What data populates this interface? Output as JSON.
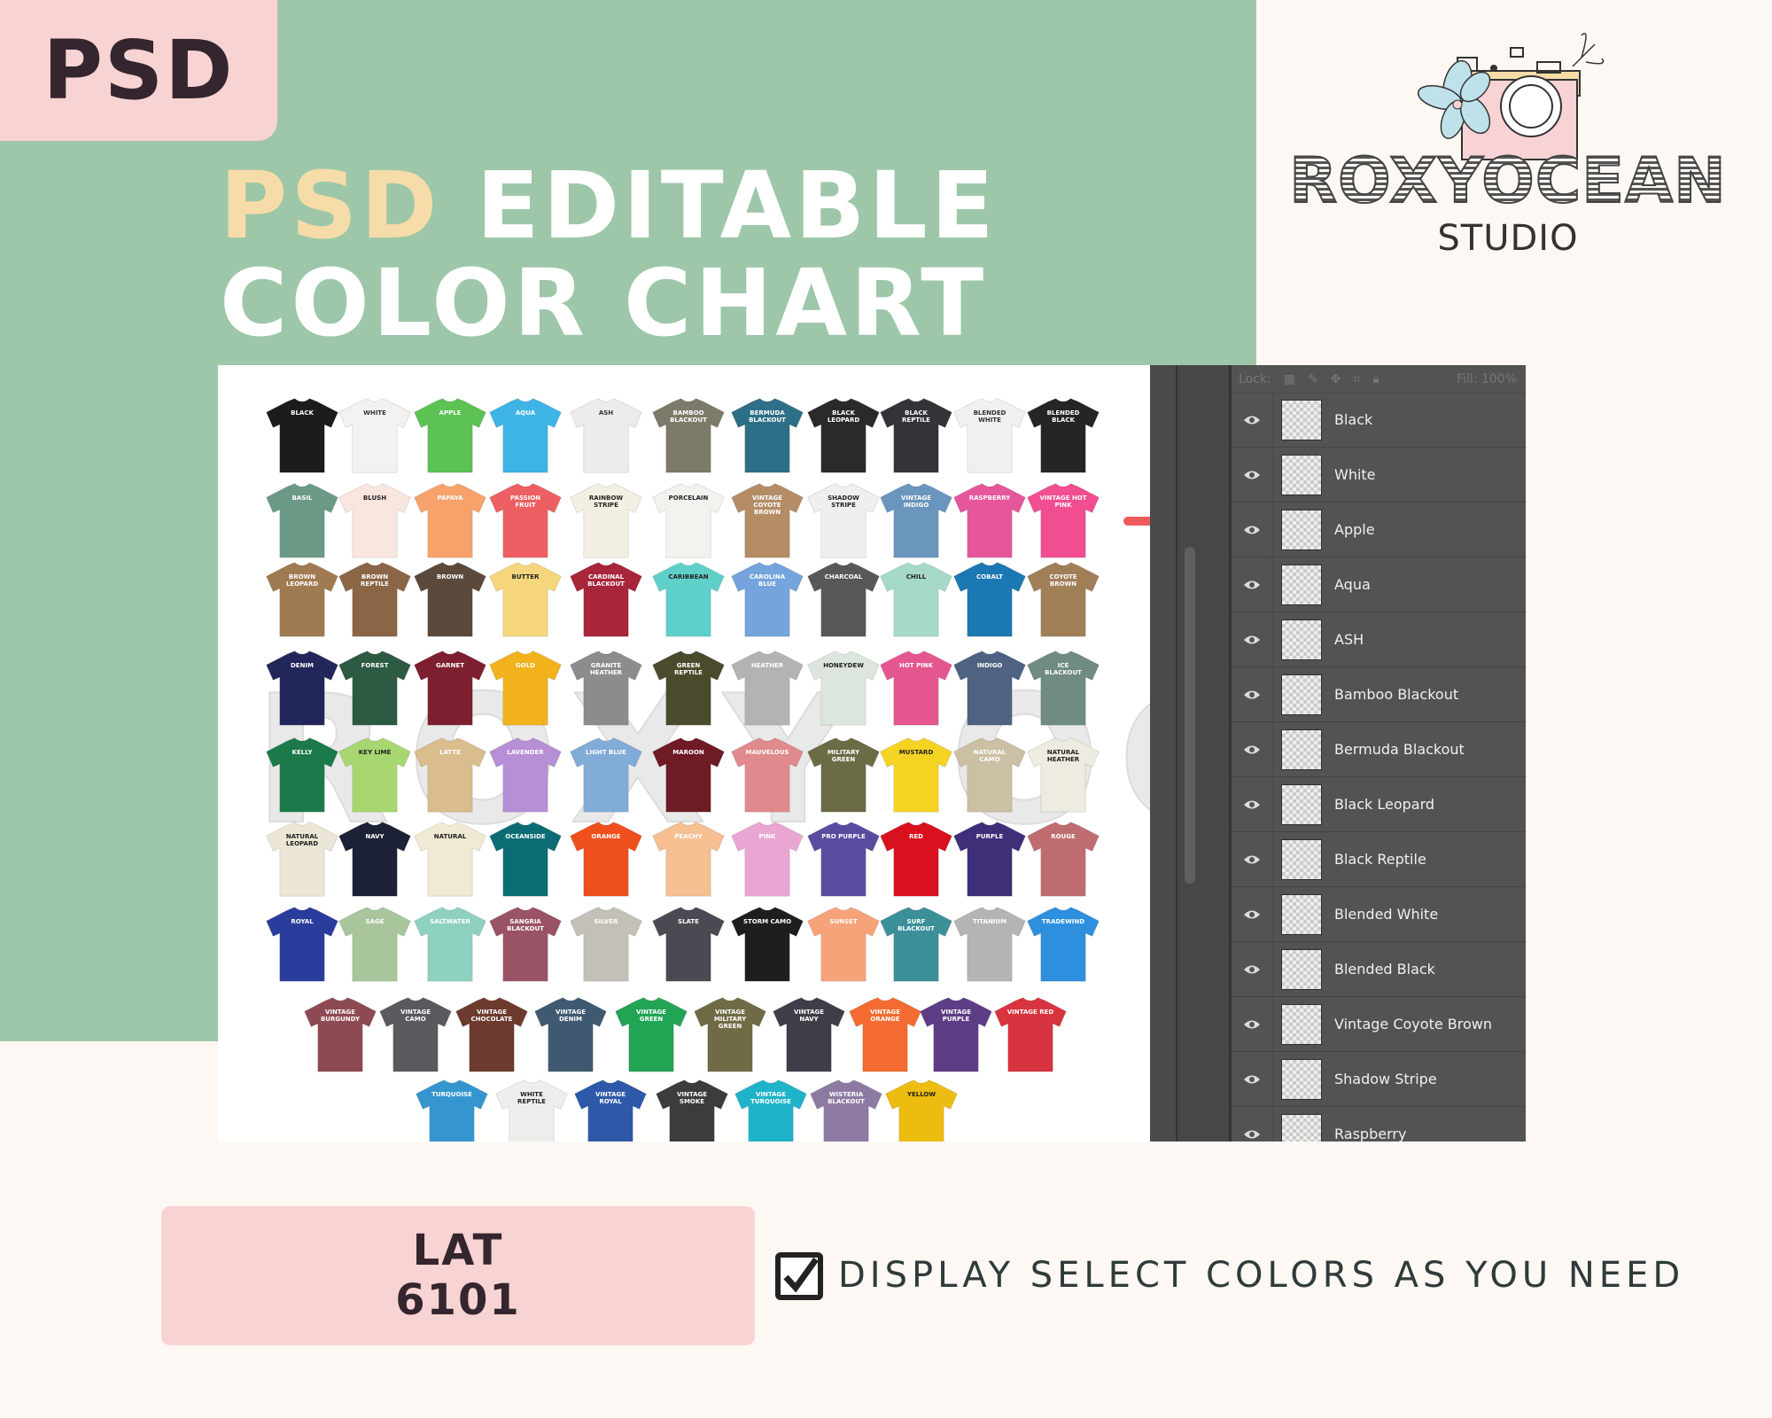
{
  "badge": {
    "text": "PSD"
  },
  "title": {
    "accent": "PSD",
    "line1_rest": "EDITABLE",
    "line2": "COLOR CHART"
  },
  "logo": {
    "name": "ROXYOCEAN",
    "sub": "STUDIO"
  },
  "colors": {
    "green": "#9dc7a8",
    "cream": "#fdf8f3",
    "pink": "#f8d3d3",
    "accent_title": "#f6dca8",
    "arrow": "#ef5b5b",
    "ps_panel": "#535353"
  },
  "chart": {
    "watermark": "ROXY OCEAN",
    "rows": [
      [
        [
          "Black",
          "#1c1c1e",
          "#fff"
        ],
        [
          "White",
          "#f3f2f0",
          "#333"
        ],
        [
          "Apple",
          "#5cc254",
          "#fff"
        ],
        [
          "Aqua",
          "#3eb3e6",
          "#fff"
        ],
        [
          "Ash",
          "#ececec",
          "#333"
        ],
        [
          "Bamboo Blackout",
          "#7d7a6a",
          "#fff"
        ],
        [
          "Bermuda Blackout",
          "#2d6f86",
          "#fff"
        ],
        [
          "Black Leopard",
          "#2a2a2c",
          "#fff"
        ],
        [
          "Black Reptile",
          "#343438",
          "#fff"
        ],
        [
          "Blended White",
          "#f2f0ee",
          "#333"
        ],
        [
          "Blended Black",
          "#252527",
          "#fff"
        ]
      ],
      [
        [
          "Basil",
          "#6a9a85",
          "#fff"
        ],
        [
          "Blush",
          "#f8e6df",
          "#222"
        ],
        [
          "Papaya",
          "#f7a26a",
          "#fff"
        ],
        [
          "Passion Fruit",
          "#ec5f63",
          "#fff"
        ],
        [
          "Rainbow Stripe",
          "#f3efe2",
          "#222"
        ],
        [
          "Porcelain",
          "#f4f2ee",
          "#222"
        ],
        [
          "Vintage Coyote Brown",
          "#b48d66",
          "#fff"
        ],
        [
          "Shadow Stripe",
          "#efefef",
          "#222"
        ],
        [
          "Vintage Indigo",
          "#6a95bd",
          "#fff"
        ],
        [
          "Raspberry",
          "#e6569b",
          "#fff"
        ],
        [
          "Vintage Hot Pink",
          "#f04e91",
          "#fff"
        ]
      ],
      [
        [
          "Brown Leopard",
          "#a07a50",
          "#fff"
        ],
        [
          "Brown Reptile",
          "#8a6646",
          "#fff"
        ],
        [
          "Brown",
          "#5b4a3c",
          "#fff"
        ],
        [
          "Butter",
          "#f6d67c",
          "#222"
        ],
        [
          "Cardinal Blackout",
          "#a8253a",
          "#fff"
        ],
        [
          "Caribbean",
          "#5fd0c9",
          "#222"
        ],
        [
          "Carolina Blue",
          "#74a4db",
          "#fff"
        ],
        [
          "Charcoal",
          "#56585a",
          "#fff"
        ],
        [
          "Chill",
          "#a6d9c8",
          "#222"
        ],
        [
          "Cobalt",
          "#1b78b3",
          "#fff"
        ],
        [
          "Coyote Brown",
          "#a07f57",
          "#fff"
        ]
      ],
      [
        [
          "Denim",
          "#23265a",
          "#fff"
        ],
        [
          "Forest",
          "#2d5a43",
          "#fff"
        ],
        [
          "Garnet",
          "#7e1f30",
          "#fff"
        ],
        [
          "Gold",
          "#f2b21b",
          "#fff"
        ],
        [
          "Granite Heather",
          "#8c8c8e",
          "#fff"
        ],
        [
          "Green Reptile",
          "#4a4a2c",
          "#fff"
        ],
        [
          "Heather",
          "#b3b3b3",
          "#fff"
        ],
        [
          "Honeydew",
          "#dde6dc",
          "#222"
        ],
        [
          "Hot Pink",
          "#e4568e",
          "#fff"
        ],
        [
          "Indigo",
          "#4f6282",
          "#fff"
        ],
        [
          "Ice Blackout",
          "#708a84",
          "#fff"
        ]
      ],
      [
        [
          "Kelly",
          "#1c7a4a",
          "#fff"
        ],
        [
          "Key Lime",
          "#a8d771",
          "#222"
        ],
        [
          "Latte",
          "#d9bd8d",
          "#fff"
        ],
        [
          "Lavender",
          "#b68fd6",
          "#fff"
        ],
        [
          "Light Blue",
          "#82acd8",
          "#fff"
        ],
        [
          "Maroon",
          "#6e1b25",
          "#fff"
        ],
        [
          "Mauvelous",
          "#e08a8d",
          "#fff"
        ],
        [
          "Military Green",
          "#6b6b45",
          "#fff"
        ],
        [
          "Mustard",
          "#f5d323",
          "#222"
        ],
        [
          "Natural Camo",
          "#cbbfa4",
          "#fff"
        ],
        [
          "Natural Heather",
          "#eeebe0",
          "#222"
        ]
      ],
      [
        [
          "Natural Leopard",
          "#ece6d6",
          "#222"
        ],
        [
          "Navy",
          "#1c2136",
          "#fff"
        ],
        [
          "Natural",
          "#f0e9d3",
          "#222"
        ],
        [
          "Oceanside",
          "#0b6d73",
          "#fff"
        ],
        [
          "Orange",
          "#ef4f1c",
          "#fff"
        ],
        [
          "Peachy",
          "#f6c093",
          "#fff"
        ],
        [
          "Pink",
          "#eaa6d3",
          "#fff"
        ],
        [
          "Pro Purple",
          "#5b4ba0",
          "#fff"
        ],
        [
          "Red",
          "#d9101e",
          "#fff"
        ],
        [
          "Purple",
          "#3f2f79",
          "#fff"
        ],
        [
          "Rouge",
          "#bf6c70",
          "#fff"
        ]
      ],
      [
        [
          "Royal",
          "#2a3c9c",
          "#fff"
        ],
        [
          "Sage",
          "#a8c59b",
          "#fff"
        ],
        [
          "Saltwater",
          "#8fd1c0",
          "#fff"
        ],
        [
          "Sangria Blackout",
          "#9a5364",
          "#fff"
        ],
        [
          "Silver",
          "#c3c0b8",
          "#fff"
        ],
        [
          "Slate",
          "#4a4a52",
          "#fff"
        ],
        [
          "Storm Camo",
          "#1e1e20",
          "#fff"
        ],
        [
          "Sunset",
          "#f7a379",
          "#fff"
        ],
        [
          "Surf Blackout",
          "#3b8f98",
          "#fff"
        ],
        [
          "Titanium",
          "#b5b3b3",
          "#fff"
        ],
        [
          "Tradewind",
          "#2d8fde",
          "#fff"
        ]
      ],
      [
        [
          "Vintage Burgundy",
          "#8d4a52",
          "#fff"
        ],
        [
          "Vintage Camo",
          "#5a5a5e",
          "#fff"
        ],
        [
          "Vintage Chocolate",
          "#6d3a2e",
          "#fff"
        ],
        [
          "Vintage Denim",
          "#3f5a70",
          "#fff"
        ],
        [
          "Vintage Green",
          "#22a455",
          "#fff"
        ],
        [
          "Vintage Military Green",
          "#6f6b45",
          "#fff"
        ],
        [
          "Vintage Navy",
          "#3d3e48",
          "#fff"
        ],
        [
          "Vintage Orange",
          "#f36b30",
          "#fff"
        ],
        [
          "Vintage Purple",
          "#5d3d86",
          "#fff"
        ],
        [
          "Vintage Red",
          "#d8343f",
          "#fff"
        ]
      ],
      [
        [
          "Turquoise",
          "#3596cf",
          "#fff"
        ],
        [
          "White Reptile",
          "#eeeeee",
          "#222"
        ],
        [
          "Vintage Royal",
          "#2d59a8",
          "#fff"
        ],
        [
          "Vintage Smoke",
          "#3c3b3d",
          "#fff"
        ],
        [
          "Vintage Turquoise",
          "#1fb3c9",
          "#fff"
        ],
        [
          "Wisteria Blackout",
          "#8d7aa3",
          "#fff"
        ],
        [
          "Yellow",
          "#ecbd10",
          "#222"
        ]
      ]
    ]
  },
  "photoshop": {
    "lock_label": "Lock:",
    "fill_label": "Fill:",
    "fill_value": "100%",
    "layers": [
      "Black",
      "White",
      "Apple",
      "Aqua",
      "ASH",
      "Bamboo Blackout",
      "Bermuda Blackout",
      "Black Leopard",
      "Black Reptile",
      "Blended White",
      "Blended Black",
      "Vintage Coyote Brown",
      "Shadow Stripe",
      "Raspberry"
    ]
  },
  "product": {
    "line1": "LAT",
    "line2": "6101"
  },
  "feature": {
    "checked": true,
    "text": "DISPLAY SELECT COLORS AS YOU NEED"
  }
}
